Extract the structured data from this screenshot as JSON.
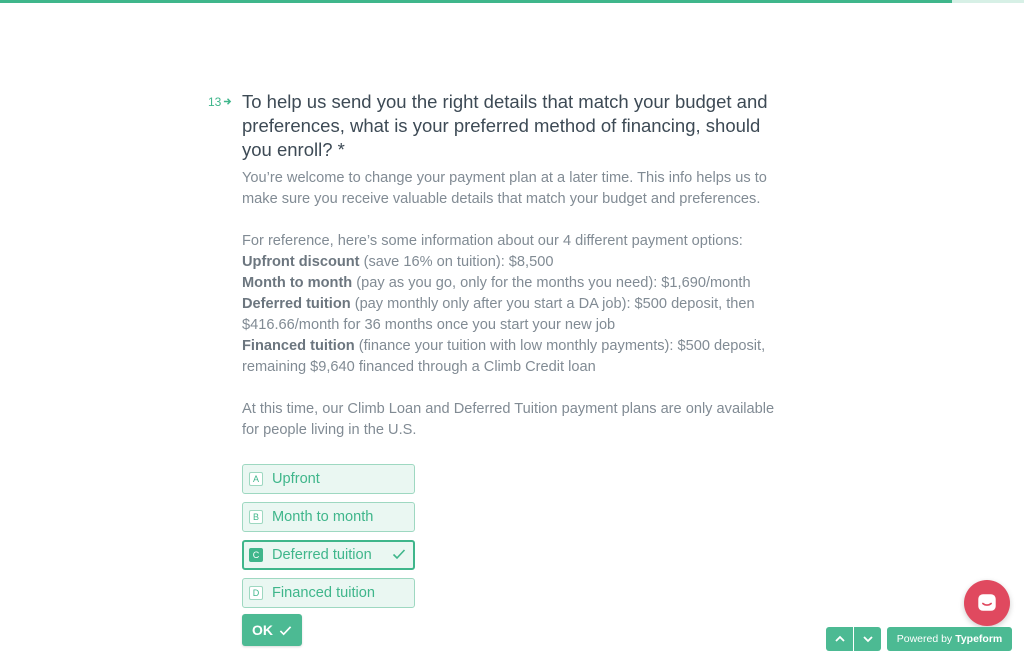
{
  "progress": {
    "fraction": 0.93,
    "color": "#3fb68b"
  },
  "question": {
    "number": "13",
    "arrow_icon": "arrow-right-icon",
    "title": "To help us send you the right details that match your budget and preferences, what is your preferred method of financing, should you enroll? *",
    "desc_intro": "You’re welcome to change your payment plan at a later time. This info helps us to make sure you receive valuable details that match your budget and preferences.",
    "desc_reference": "For reference, here’s some information about our 4 different payment options:",
    "options_info": [
      {
        "name": "Upfront discount",
        "detail": " (save 16% on tuition): $8,500"
      },
      {
        "name": "Month to month",
        "detail": " (pay as you go, only for the months you need): $1,690/month"
      },
      {
        "name": "Deferred tuition",
        "detail": " (pay monthly only after you start a DA job): $500 deposit, then $416.66/month for 36 months once you start your new job"
      },
      {
        "name": "Financed tuition",
        "detail": " (finance your tuition with low monthly payments): $500 deposit, remaining $9,640 financed through a Climb Credit loan"
      }
    ],
    "desc_note": "At this time, our Climb Loan and Deferred Tuition payment plans are only available for people living in the U.S."
  },
  "choices": [
    {
      "key": "A",
      "label": "Upfront",
      "selected": false
    },
    {
      "key": "B",
      "label": "Month to month",
      "selected": false
    },
    {
      "key": "C",
      "label": "Deferred tuition",
      "selected": true
    },
    {
      "key": "D",
      "label": "Financed tuition",
      "selected": false
    }
  ],
  "ok_button": {
    "label": "OK",
    "icon": "check-icon"
  },
  "chat_button": {
    "icon": "chat-icon"
  },
  "nav": {
    "up_icon": "chevron-up-icon",
    "down_icon": "chevron-down-icon"
  },
  "powered": {
    "prefix": "Powered by",
    "brand": "Typeform"
  }
}
